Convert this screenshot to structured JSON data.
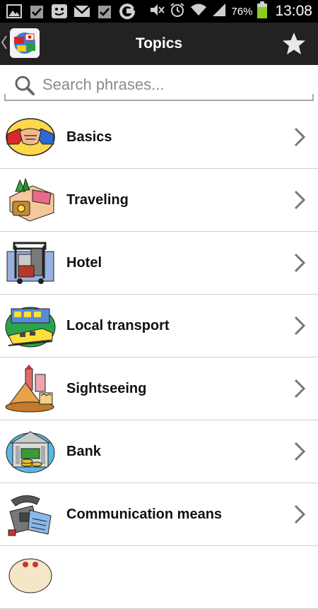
{
  "status_bar": {
    "battery_percent": "76%",
    "time": "13:08",
    "icons": [
      "image-icon",
      "checkbox-icon",
      "chat-icon",
      "gmail-icon",
      "checkbox-icon",
      "google-icon",
      "mute-icon",
      "alarm-icon",
      "wifi-icon",
      "signal-icon",
      "battery-icon"
    ]
  },
  "action_bar": {
    "title": "Topics",
    "star_icon": "star-icon"
  },
  "search": {
    "placeholder": "Search phrases..."
  },
  "topics": [
    {
      "label": "Basics",
      "icon": "handshake-icon"
    },
    {
      "label": "Traveling",
      "icon": "luggage-icon"
    },
    {
      "label": "Hotel",
      "icon": "luggage-cart-icon"
    },
    {
      "label": "Local transport",
      "icon": "train-icon"
    },
    {
      "label": "Sightseeing",
      "icon": "landmarks-icon"
    },
    {
      "label": "Bank",
      "icon": "bank-icon"
    },
    {
      "label": "Communication means",
      "icon": "telephone-icon"
    }
  ],
  "colors": {
    "action_bar_bg": "#222222",
    "status_bar_bg": "#000000",
    "battery": "#8ccc1d",
    "divider": "#cfcfcf"
  }
}
